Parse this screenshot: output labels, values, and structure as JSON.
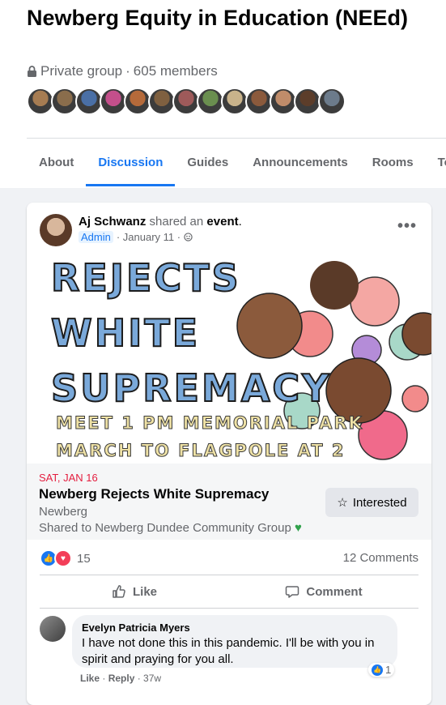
{
  "group": {
    "title": "Newberg Equity in Education (NEEd)",
    "privacy": "Private group",
    "members": "605 members"
  },
  "avatars": [
    "#a67c52",
    "#8a6d4c",
    "#4a6fa5",
    "#c44f8b",
    "#b56a3a",
    "#7f6040",
    "#9e5a5a",
    "#6a8e4f",
    "#c9b38b",
    "#8b5a3c",
    "#c08c6a",
    "#5c3d2a",
    "#6c7b8b"
  ],
  "tabs": [
    "About",
    "Discussion",
    "Guides",
    "Announcements",
    "Rooms",
    "Top"
  ],
  "post": {
    "author": "Aj Schwanz",
    "shared_an": " shared an ",
    "event_word": "event",
    "period": ".",
    "role": "Admin",
    "date": "· January 11 ·",
    "banner": {
      "line1": "REJECTS",
      "line2": "WHITE",
      "line3": "SUPREMACY",
      "line4": "MEET 1 PM MEMORIAL PARK",
      "line5": "MARCH TO FLAGPOLE AT 2"
    },
    "event": {
      "date": "SAT, JAN 16",
      "name": "Newberg Rejects White Supremacy",
      "location": "Newberg",
      "shared_to": "Shared to Newberg Dundee Community Group",
      "interested_label": "Interested"
    },
    "reaction_count": "15",
    "comments_count": "12 Comments",
    "like_label": "Like",
    "comment_label": "Comment"
  },
  "comment": {
    "author": "Evelyn Patricia Myers",
    "text": "I have not done this in this pandemic. I'll be with you in spirit and praying for you all.",
    "like_action": "Like",
    "reply_action": "Reply",
    "age": "37w",
    "like_count": "1"
  },
  "colors": {
    "accent": "#1877f2",
    "event_date": "#e41e3f",
    "banner_blue": "#7aa9da"
  }
}
